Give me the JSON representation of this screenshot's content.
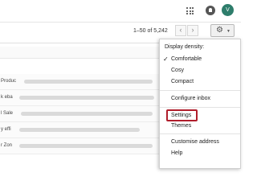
{
  "header": {
    "avatar_letter": "V",
    "icons": [
      "apps-grid-icon",
      "notifications-icon"
    ]
  },
  "toolbar": {
    "pagination": "1–50 of 5,242",
    "prev_glyph": "‹",
    "next_glyph": "›",
    "settings_icon": "gear-icon"
  },
  "inbox": {
    "row_snippets": [
      "Produc",
      "k eba",
      "l Sale",
      "y effi",
      "r Zon"
    ]
  },
  "settings_menu": {
    "section_title": "Display density:",
    "density_options": [
      {
        "label": "Comfortable",
        "checked": true
      },
      {
        "label": "Cosy",
        "checked": false
      },
      {
        "label": "Compact",
        "checked": false
      }
    ],
    "configure_inbox": "Configure inbox",
    "settings": "Settings",
    "themes": "Themes",
    "customise_address": "Customise address",
    "help": "Help",
    "highlight_color": "#b01e2c"
  }
}
